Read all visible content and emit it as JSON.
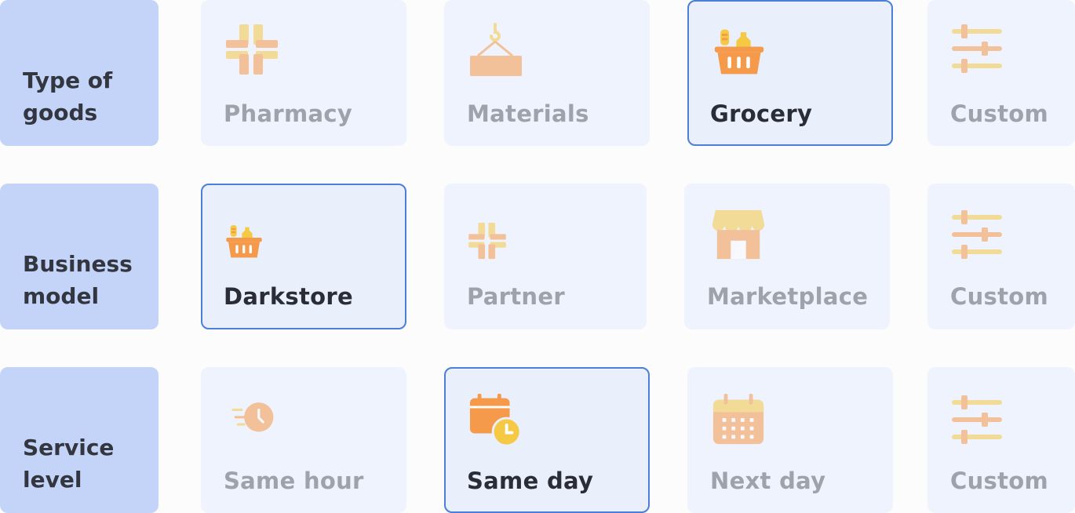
{
  "rows": [
    {
      "label": "Type of\ngoods",
      "options": [
        {
          "label": "Pharmacy",
          "icon": "pharmacy-cross-icon",
          "selected": false
        },
        {
          "label": "Materials",
          "icon": "crane-hook-icon",
          "selected": false
        },
        {
          "label": "Grocery",
          "icon": "grocery-basket-icon",
          "selected": true
        },
        {
          "label": "Custom",
          "icon": "sliders-icon",
          "selected": false
        }
      ]
    },
    {
      "label": "Business\nmodel",
      "options": [
        {
          "label": "Darkstore",
          "icon": "grocery-basket-icon",
          "selected": true
        },
        {
          "label": "Partner",
          "icon": "pharmacy-cross-icon",
          "selected": false
        },
        {
          "label": "Marketplace",
          "icon": "storefront-icon",
          "selected": false
        },
        {
          "label": "Custom",
          "icon": "sliders-icon",
          "selected": false
        }
      ]
    },
    {
      "label": "Service\nlevel",
      "options": [
        {
          "label": "Same hour",
          "icon": "fast-clock-icon",
          "selected": false
        },
        {
          "label": "Same day",
          "icon": "calendar-clock-icon",
          "selected": true
        },
        {
          "label": "Next day",
          "icon": "calendar-grid-icon",
          "selected": false
        },
        {
          "label": "Custom",
          "icon": "sliders-icon",
          "selected": false
        }
      ]
    }
  ],
  "colors": {
    "row_label_bg": "#c3d4f8",
    "card_bg": "#eff3fd",
    "selected_border": "#4b7fd8",
    "icon_orange": "#f59a4a",
    "icon_yellow": "#f6c945",
    "text_dim": "#9ea2aa",
    "text_active": "#2a2d35"
  }
}
